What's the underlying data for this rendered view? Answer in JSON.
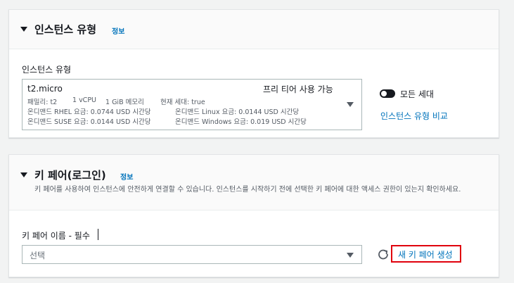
{
  "instance_type_section": {
    "title": "인스턴스 유형",
    "info_label": "정보",
    "field_label": "인스턴스 유형",
    "selected": {
      "name": "t2.micro",
      "free_tier": "프리 티어 사용 가능",
      "specs": {
        "family": "패밀리: t2",
        "vcpu": "1 vCPU",
        "memory": "1 GiB 메모리",
        "current_generation": "현재 세대: true"
      },
      "pricing": {
        "rhel": "온디맨드 RHEL 요금: 0.0744 USD 시간당",
        "linux": "온디맨드 Linux 요금: 0.0144 USD 시간당",
        "suse": "온디맨드 SUSE 요금: 0.0144 USD 시간당",
        "windows": "온디맨드 Windows 요금: 0.019 USD 시간당"
      }
    },
    "all_generations_toggle": {
      "label": "모든 세대",
      "on": false
    },
    "compare_link": "인스턴스 유형 비교"
  },
  "key_pair_section": {
    "title": "키 페어(로그인)",
    "info_label": "정보",
    "description": "키 페어를 사용하여 인스턴스에 안전하게 연결할 수 있습니다. 인스턴스를 시작하기 전에 선택한 키 페어에 대한 액세스 권한이 있는지 확인하세요.",
    "field_label": "키 페어 이름 - 필수",
    "select_placeholder": "선택",
    "create_link": "새 키 페어 생성"
  },
  "colors": {
    "link": "#0073bb",
    "highlight_border": "#e0000d",
    "text": "#16191f",
    "muted": "#545b64"
  }
}
